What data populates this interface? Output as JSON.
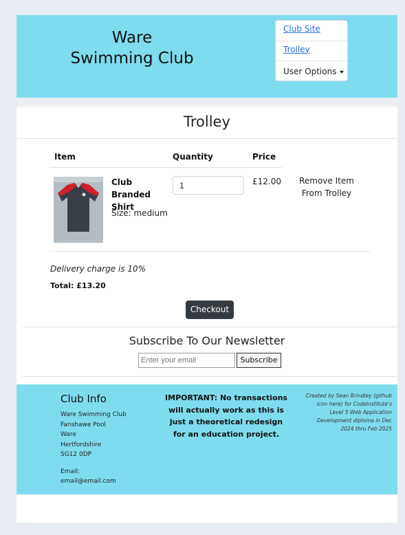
{
  "header": {
    "title_line1": "Ware",
    "title_line2": "Swimming Club"
  },
  "nav": {
    "club_site": "Club Site",
    "trolley": "Trolley",
    "user_options": "User Options"
  },
  "page": {
    "title": "Trolley"
  },
  "table": {
    "headers": [
      "Item",
      "Quantity",
      "Price"
    ],
    "rows": [
      {
        "name": "Club Branded Shirt",
        "size": "Size: medium",
        "quantity": "1",
        "price": "£12.00",
        "remove": "Remove Item From Trolley"
      }
    ]
  },
  "summary": {
    "delivery": "Delivery charge is 10%",
    "total": "Total: £13.20",
    "checkout": "Checkout"
  },
  "newsletter": {
    "title": "Subscribe To Our Newsletter",
    "placeholder": "Enter your email",
    "button": "Subscribe"
  },
  "footer": {
    "club_info_title": "Club Info",
    "address_lines": [
      "Ware Swimming Club",
      "Fanshawe Pool",
      "Ware",
      "Hertfordshire",
      "SG12 0DP"
    ],
    "email_label": "Email:",
    "email": "email@email.com",
    "important": "IMPORTANT: No transactions will actually work as this is just a theoretical redesign for an education project.",
    "credit": "Created by Sean Brindley (github icon here) for CodeInstitute's Level 5 Web Application Development diploma in Dec 2024 thru Feb 2025"
  },
  "colors": {
    "brand_cyan": "#7fdcef",
    "dark_button": "#343a40",
    "link_blue": "#2a6fdb"
  },
  "icons": {
    "user_options": "caret-down-icon"
  }
}
